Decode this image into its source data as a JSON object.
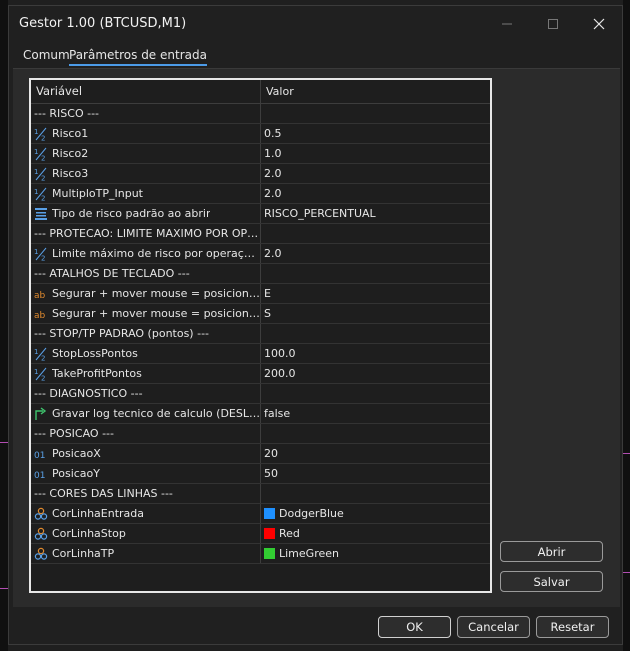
{
  "window": {
    "title": "Gestor 1.00 (BTCUSD,M1)"
  },
  "tabs": [
    {
      "label": "Comum",
      "active": false
    },
    {
      "label": "Parâmetros de entrada",
      "active": true
    }
  ],
  "grid": {
    "headers": {
      "variable": "Variável",
      "value": "Valor"
    },
    "rows": [
      {
        "type": "section",
        "label": "--- RISCO ---",
        "value": ""
      },
      {
        "type": "param",
        "icon": "half-icon",
        "label": "Risco1",
        "value": "0.5"
      },
      {
        "type": "param",
        "icon": "half-icon",
        "label": "Risco2",
        "value": "1.0"
      },
      {
        "type": "param",
        "icon": "half-icon",
        "label": "Risco3",
        "value": "2.0"
      },
      {
        "type": "param",
        "icon": "half-icon",
        "label": "MultiploTP_Input",
        "value": "2.0"
      },
      {
        "type": "param",
        "icon": "enum-list-icon",
        "label": "Tipo de risco padrão ao abrir",
        "value": "RISCO_PERCENTUAL"
      },
      {
        "type": "section",
        "label": "--- PROTECAO: LIMITE MAXIMO POR OPERACAO ---",
        "value": ""
      },
      {
        "type": "param",
        "icon": "half-icon",
        "label": "Limite máximo de risco por operação (% da banca)",
        "value": "2.0"
      },
      {
        "type": "section",
        "label": "--- ATALHOS DE TECLADO ---",
        "value": ""
      },
      {
        "type": "param",
        "icon": "text-ab-icon",
        "label": "Segurar + mover mouse = posiciona linha de entrada",
        "value": "E"
      },
      {
        "type": "param",
        "icon": "text-ab-icon",
        "label": "Segurar + mover mouse = posiciona linha de stop",
        "value": "S"
      },
      {
        "type": "section",
        "label": "--- STOP/TP PADRAO (pontos) ---",
        "value": ""
      },
      {
        "type": "param",
        "icon": "half-icon",
        "label": "StopLossPontos",
        "value": "100.0"
      },
      {
        "type": "param",
        "icon": "half-icon",
        "label": "TakeProfitPontos",
        "value": "200.0"
      },
      {
        "type": "section",
        "label": "--- DIAGNOSTICO ---",
        "value": ""
      },
      {
        "type": "param",
        "icon": "bool-arrow-icon",
        "label": "Gravar log tecnico de calculo (DESLIGADO)",
        "value": "false"
      },
      {
        "type": "section",
        "label": "--- POSICAO ---",
        "value": ""
      },
      {
        "type": "param",
        "icon": "int-01-icon",
        "label": "PosicaoX",
        "value": "20"
      },
      {
        "type": "param",
        "icon": "int-01-icon",
        "label": "PosicaoY",
        "value": "50"
      },
      {
        "type": "section",
        "label": "--- CORES DAS LINHAS ---",
        "value": ""
      },
      {
        "type": "param",
        "icon": "color-icon",
        "label": "CorLinhaEntrada",
        "value": "DodgerBlue",
        "swatch": "#1e90ff"
      },
      {
        "type": "param",
        "icon": "color-icon",
        "label": "CorLinhaStop",
        "value": "Red",
        "swatch": "#ff0000"
      },
      {
        "type": "param",
        "icon": "color-icon",
        "label": "CorLinhaTP",
        "value": "LimeGreen",
        "swatch": "#32cd32"
      }
    ]
  },
  "buttons": {
    "open": "Abrir",
    "save": "Salvar",
    "ok": "OK",
    "cancel": "Cancelar",
    "reset": "Resetar"
  },
  "colors": {
    "accent": "#4c9be8",
    "icon_blue": "#5aa0e6",
    "icon_orange": "#e08a2e",
    "icon_green": "#3ec46d"
  }
}
